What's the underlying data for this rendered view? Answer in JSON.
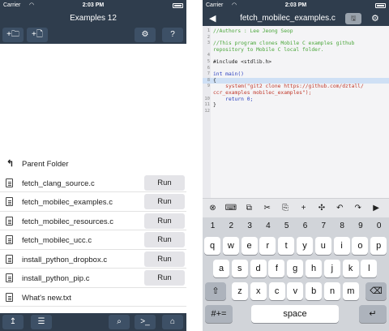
{
  "left": {
    "status": {
      "carrier": "Carrier",
      "time": "2:03 PM"
    },
    "title": "Examples 12",
    "toolbar": {
      "new_folder": "+🗀",
      "new_file": "+🗋",
      "settings": "⚙",
      "help": "?"
    },
    "parent_folder": "Parent Folder",
    "files": [
      {
        "name": "fetch_clang_source.c",
        "run": "Run"
      },
      {
        "name": "fetch_mobilec_examples.c",
        "run": "Run"
      },
      {
        "name": "fetch_mobilec_resources.c",
        "run": "Run"
      },
      {
        "name": "fetch_mobilec_ucc.c",
        "run": "Run"
      },
      {
        "name": "install_python_dropbox.c",
        "run": "Run"
      },
      {
        "name": "install_python_pip.c",
        "run": "Run"
      },
      {
        "name": "What's new.txt",
        "run": ""
      }
    ],
    "bottom": {
      "up": "↥",
      "list": "☰",
      "search": "⌕",
      "terminal": ">_",
      "home": "⌂"
    }
  },
  "right": {
    "status": {
      "carrier": "Carrier",
      "time": "2:03 PM"
    },
    "title": "fetch_mobilec_examples.c",
    "code_lines": [
      {
        "n": "1",
        "t": "//Authors : Lee Jeong Seop",
        "c": "c-comment"
      },
      {
        "n": "2",
        "t": "",
        "c": "c-plain"
      },
      {
        "n": "3",
        "t": "//This program clones Mobile C examples github",
        "c": "c-comment"
      },
      {
        "n": "",
        "t": "repository to Mobile C local folder.",
        "c": "c-comment"
      },
      {
        "n": "4",
        "t": "",
        "c": "c-plain"
      },
      {
        "n": "5",
        "t": "#include <stdlib.h>",
        "c": "c-plain"
      },
      {
        "n": "6",
        "t": "",
        "c": "c-plain"
      },
      {
        "n": "7",
        "t": "int main()",
        "c": "c-plain"
      },
      {
        "n": "8",
        "t": "{",
        "c": "c-plain"
      },
      {
        "n": "9",
        "t": "    system(\"git2 clone https://github.com/dztall/",
        "c": "c-str"
      },
      {
        "n": "",
        "t": "ccr_examples mobilec_examples\");",
        "c": "c-str"
      },
      {
        "n": "10",
        "t": "    return 0;",
        "c": "c-plain"
      },
      {
        "n": "11",
        "t": "}",
        "c": "c-plain"
      },
      {
        "n": "12",
        "t": "",
        "c": "c-plain"
      }
    ],
    "editbar": [
      "⊗",
      "⌨",
      "⧉",
      "✂",
      "⎘",
      "+",
      "✣",
      "↶",
      "↷",
      "▶"
    ],
    "keyboard": {
      "numbers": [
        "1",
        "2",
        "3",
        "4",
        "5",
        "6",
        "7",
        "8",
        "9",
        "0"
      ],
      "row1": [
        "q",
        "w",
        "e",
        "r",
        "t",
        "y",
        "u",
        "i",
        "o",
        "p"
      ],
      "row2": [
        "a",
        "s",
        "d",
        "f",
        "g",
        "h",
        "j",
        "k",
        "l"
      ],
      "row3": [
        "z",
        "x",
        "c",
        "v",
        "b",
        "n",
        "m"
      ],
      "shift": "⇧",
      "delete": "⌫",
      "symbols": "#+=",
      "space": "space",
      "return": "↵"
    }
  }
}
